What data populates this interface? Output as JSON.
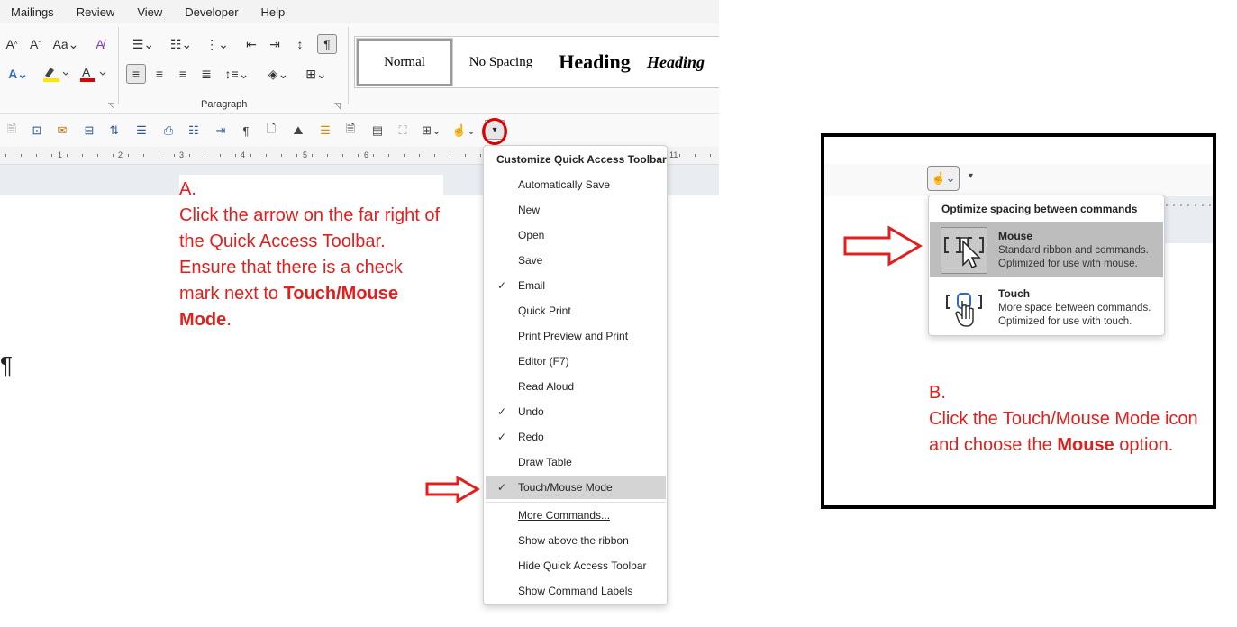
{
  "menubar": [
    "Mailings",
    "Review",
    "View",
    "Developer",
    "Help"
  ],
  "ribbon": {
    "paragraph_label": "Paragraph",
    "styles": [
      {
        "label": "Normal"
      },
      {
        "label": "No Spacing"
      },
      {
        "label": "Heading"
      },
      {
        "label": "Heading"
      }
    ]
  },
  "ruler_numbers": [
    "1",
    "2",
    "3",
    "4",
    "5",
    "6",
    "11"
  ],
  "note_a": {
    "letter": "A.",
    "text_part": "Click the arrow on the far right of the Quick Access Toolbar. Ensure that there is a check mark next to ",
    "bold": "Touch/Mouse Mode",
    "end": "."
  },
  "qat_menu": {
    "title": "Customize Quick Access Toolbar",
    "items": [
      {
        "label": "Automatically Save",
        "checked": false
      },
      {
        "label": "New",
        "checked": false
      },
      {
        "label": "Open",
        "checked": false
      },
      {
        "label": "Save",
        "checked": false
      },
      {
        "label": "Email",
        "checked": true
      },
      {
        "label": "Quick Print",
        "checked": false
      },
      {
        "label": "Print Preview and Print",
        "checked": false
      },
      {
        "label": "Editor (F7)",
        "checked": false
      },
      {
        "label": "Read Aloud",
        "checked": false
      },
      {
        "label": "Undo",
        "checked": true
      },
      {
        "label": "Redo",
        "checked": true
      },
      {
        "label": "Draw Table",
        "checked": false
      },
      {
        "label": "Touch/Mouse Mode",
        "checked": true
      }
    ],
    "extra": [
      {
        "label": "More Commands..."
      },
      {
        "label": "Show above the ribbon"
      },
      {
        "label": "Hide Quick Access Toolbar"
      },
      {
        "label": "Show Command Labels"
      }
    ],
    "check_glyph": "✓"
  },
  "panel_b": {
    "menu_title": "Optimize spacing between commands",
    "options": [
      {
        "name": "Mouse",
        "desc1": "Standard ribbon and commands.",
        "desc2": "Optimized for use with mouse."
      },
      {
        "name": "Touch",
        "desc1": "More space between commands.",
        "desc2": "Optimized for use with touch."
      }
    ],
    "note": {
      "letter": "B.",
      "text_part": "Click the Touch/Mouse Mode icon and choose the ",
      "bold": "Mouse",
      "end": " option."
    }
  },
  "colors": {
    "annotation_red": "#e0201e",
    "highlight": "#d4d4d4"
  }
}
